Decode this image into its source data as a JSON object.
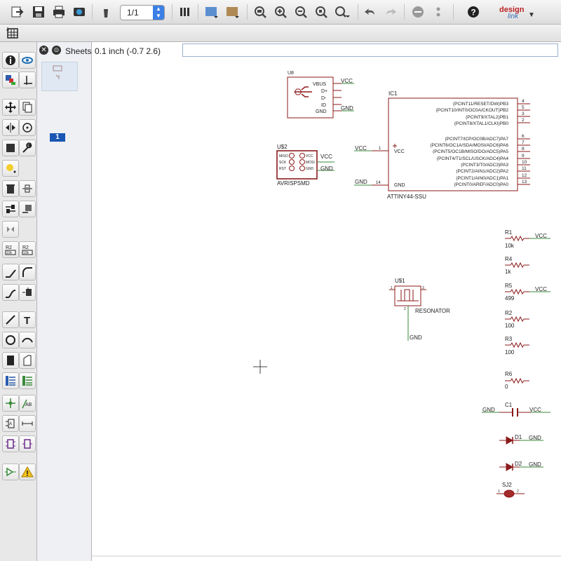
{
  "toolbar": {
    "page_value": "1/1",
    "icons": [
      "open-icon",
      "save-icon",
      "print-icon",
      "cam-icon",
      "paste-icon",
      "layers-icon",
      "grid-icon",
      "layer-settings-icon",
      "zoom-fit-icon",
      "zoom-in-icon",
      "zoom-out-icon",
      "zoom-redraw-icon",
      "zoom-select-icon",
      "undo-icon",
      "redo-icon",
      "stop-icon",
      "dot-icon",
      "help-icon"
    ],
    "logo_text_1": "design",
    "logo_text_2": "link"
  },
  "sheets": {
    "title": "Sheets",
    "number": "1"
  },
  "status": {
    "grid_coord": "0.1 inch (-0.7 2.6)",
    "command_value": ""
  },
  "schematic": {
    "u8": {
      "ref": "U8",
      "pins": [
        "VBUS",
        "D+",
        "D-",
        "ID",
        "GND"
      ],
      "net_vcc": "VCC",
      "net_gnd": "GND"
    },
    "us2": {
      "ref": "U$2",
      "pins_left": [
        "MISO",
        "SCK",
        "RST"
      ],
      "pins_right": [
        "VCC",
        "MOSI",
        "GND"
      ],
      "value": "AVRISPSMD",
      "net_vcc": "VCC",
      "net_gnd": "GND"
    },
    "ic1": {
      "ref": "IC1",
      "value": "ATTINY44-SSU",
      "left_pins": [
        {
          "num": "1",
          "name": "VCC",
          "net": "VCC"
        },
        {
          "num": "14",
          "name": "GND",
          "net": "GND"
        }
      ],
      "right_pins": [
        {
          "name": "(PCINT11/RESET/DW)PB3",
          "num": "4"
        },
        {
          "name": "(PCINT10/INT0/OC0A/CKOUT)PB2",
          "num": "5"
        },
        {
          "name": "(PCINT9/XTAL2)PB1",
          "num": "3"
        },
        {
          "name": "(PCINT8/XTAL1/CLKI)PB0",
          "num": "2"
        },
        {
          "name": "(PCINT7/ICP/OC0B/ADC7)PA7",
          "num": "6"
        },
        {
          "name": "(PCINT6/OC1A/SDA/MOSI/ADC6)PA6",
          "num": "7"
        },
        {
          "name": "(PCINT5/OC1B/MISO/DO/ADC5)PA5",
          "num": "8"
        },
        {
          "name": "(PCINT4/T1/SCL/USCK/ADC4)PA4",
          "num": "9"
        },
        {
          "name": "(PCINT3/T0/ADC3)PA3",
          "num": "10"
        },
        {
          "name": "(PCINT2/AIN1/ADC2)PA2",
          "num": "11"
        },
        {
          "name": "(PCINT1/AIN0/ADC1)PA1",
          "num": "12"
        },
        {
          "name": "(PCINT0/AREF/ADC0)PA0",
          "num": "13"
        }
      ]
    },
    "resonator": {
      "ref": "U$1",
      "value": "RESONATOR",
      "pin_left": "1",
      "pin_right": "3",
      "pin_bottom": "2",
      "net_gnd": "GND"
    },
    "resistors": [
      {
        "ref": "R1",
        "value": "10k",
        "net": "VCC"
      },
      {
        "ref": "R4",
        "value": "1k",
        "net": ""
      },
      {
        "ref": "R5",
        "value": "499",
        "net": "VCC"
      },
      {
        "ref": "R2",
        "value": "100",
        "net": ""
      },
      {
        "ref": "R3",
        "value": "100",
        "net": ""
      },
      {
        "ref": "R6",
        "value": "0",
        "net": ""
      }
    ],
    "c1": {
      "ref": "C1",
      "net_left": "GND",
      "net_right": "VCC"
    },
    "d1": {
      "ref": "D1",
      "net": "GND"
    },
    "d2": {
      "ref": "D2",
      "net": "GND"
    },
    "sj2": {
      "ref": "SJ2",
      "pin1": "1",
      "pin2": "2"
    }
  },
  "colors": {
    "symbol": "#8b1a1a",
    "wire": "#3a8a3a",
    "pin": "#8b1a1a",
    "sheet_number_bg": "#1a56b4",
    "accent_blue": "#3b7fe6"
  }
}
